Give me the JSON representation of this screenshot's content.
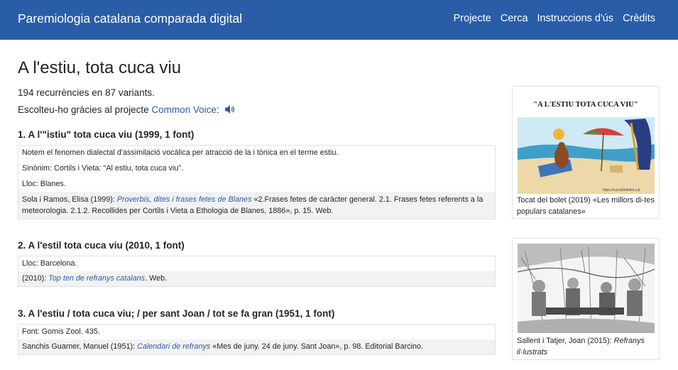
{
  "navbar": {
    "brand": "Paremiologia catalana comparada digital",
    "links": [
      "Projecte",
      "Cerca",
      "Instruccions d'ús",
      "Crèdits"
    ],
    "background": "#2a5da7"
  },
  "page": {
    "title": "A l'estiu, tota cuca viu",
    "summary": "194 recurrències en 87 variants.",
    "voice_prefix": "Escolteu-ho gràcies al projecte ",
    "voice_link": "Common Voice",
    "voice_suffix": ":",
    "speaker_icon": "speaker-icon"
  },
  "variants": [
    {
      "title": "1. A l'\"istiu\" tota cuca viu (1999, 1 font)",
      "notes": [
        "Notem el fenomen dialectal d'assimilació vocàlica per atracció de la i tònica en el terme estiu.",
        "Sinònim: Cortils i Vieta: \"Al estiu, tota cuca viu\".",
        "Lloc: Blanes."
      ],
      "reference": {
        "author": "Sola i Ramos, Elisa (1999): ",
        "work": "Proverbis, dites i frases fetes de Blanes",
        "detail": " «2.Frases fetes de caràcter general. 2.1. Frases fetes referents a la meteorologia. 2.1.2. Recollides per Cortils i Vieta a Ethologia de Blanes, 1886», p. 15. Web."
      }
    },
    {
      "title": "2. A l'estil tota cuca viu (2010, 1 font)",
      "notes": [
        "Lloc: Barcelona."
      ],
      "reference": {
        "author": "(2010): ",
        "work": "Top ten de refranys catalans",
        "detail": ". Web."
      }
    },
    {
      "title": "3. A l'estiu / tota cuca viu; / per sant Joan / tot se fa gran (1951, 1 font)",
      "notes": [
        "Font: Gomis Zool. 435."
      ],
      "reference": {
        "author": "Sanchis Guarner, Manuel (1951): ",
        "work": "Calendari de refranys",
        "detail": " «Mes de juny. 24 de juny. Sant Joan», p. 98. Editorial Barcino."
      }
    }
  ],
  "sidebar": {
    "card1": {
      "image_heading": "\"A L'ESTIU TOTA CUCA VIU\"",
      "image_url": "https://cocatdelbolet.cat",
      "caption": "Tocat del bolet (2019) «Les millors di-tes populars catalanes»"
    },
    "card2": {
      "caption_prefix": "Sallent i Tatjer, Joan (2015): ",
      "caption_title": "Refranys il·lustrats"
    }
  }
}
